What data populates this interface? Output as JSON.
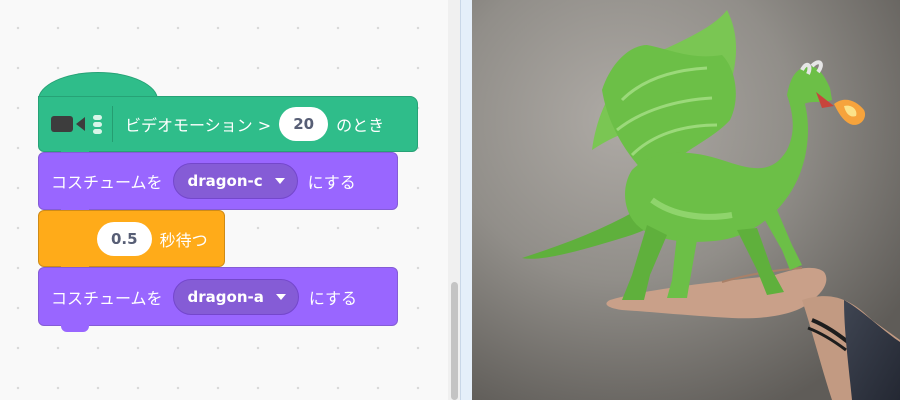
{
  "blocks": {
    "hat": {
      "icon": "video-sensing-icon",
      "label_prefix": "ビデオモーション >",
      "threshold": "20",
      "label_suffix": "のとき"
    },
    "switch_costume_1": {
      "label_prefix": "コスチュームを",
      "costume": "dragon-c",
      "label_suffix": "にする"
    },
    "wait": {
      "seconds": "0.5",
      "label": "秒待つ"
    },
    "switch_costume_2": {
      "label_prefix": "コスチュームを",
      "costume": "dragon-a",
      "label_suffix": "にする"
    }
  },
  "stage": {
    "sprite": "dragon-sprite",
    "background": "webcam-video-hand-icon"
  },
  "colors": {
    "events_green": "#2fbd8a",
    "looks_purple": "#9966ff",
    "control_orange": "#ffab19",
    "dragon_green": "#6cbf47"
  }
}
